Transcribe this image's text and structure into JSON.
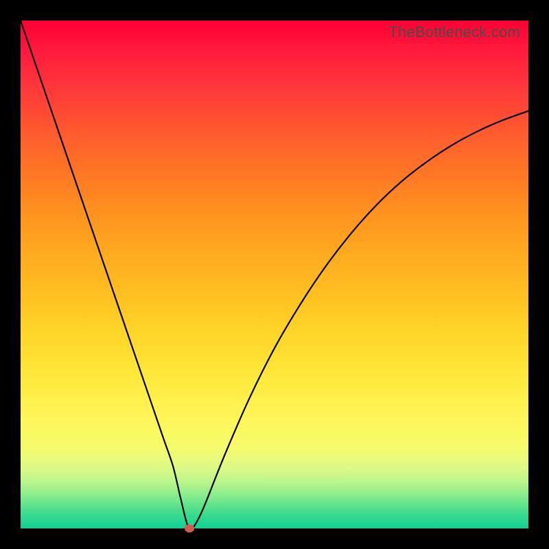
{
  "watermark": "TheBottleneck.com",
  "colors": {
    "frame": "#000000",
    "curve": "#000000",
    "marker": "#d35a4f",
    "gradient_top": "#ff0033",
    "gradient_bottom": "#11d094"
  },
  "chart_data": {
    "type": "line",
    "title": "",
    "xlabel": "",
    "ylabel": "",
    "xlim": [
      0,
      100
    ],
    "ylim": [
      0,
      100
    ],
    "grid": false,
    "legend": false,
    "series": [
      {
        "name": "bottleneck-curve",
        "x": [
          0,
          4,
          8,
          12,
          16,
          20,
          24,
          28,
          30,
          31.5,
          33,
          34,
          36,
          40,
          45,
          50,
          55,
          60,
          65,
          70,
          75,
          80,
          85,
          90,
          95,
          100
        ],
        "values": [
          100,
          88.3,
          76.6,
          64.9,
          53.2,
          41.5,
          29.8,
          18.1,
          12.3,
          6.0,
          0.2,
          0.2,
          4.0,
          14.0,
          25.5,
          35.5,
          44.0,
          51.5,
          58.0,
          63.6,
          68.3,
          72.2,
          75.5,
          78.2,
          80.4,
          82.2
        ]
      }
    ],
    "annotations": [
      {
        "name": "minimum-marker",
        "x": 33.2,
        "y": 0.0
      }
    ],
    "notes": "Values are estimated from pixel positions of the curve on an unlabeled axis; y is percent of plot height from bottom, x is percent of plot width from left."
  }
}
